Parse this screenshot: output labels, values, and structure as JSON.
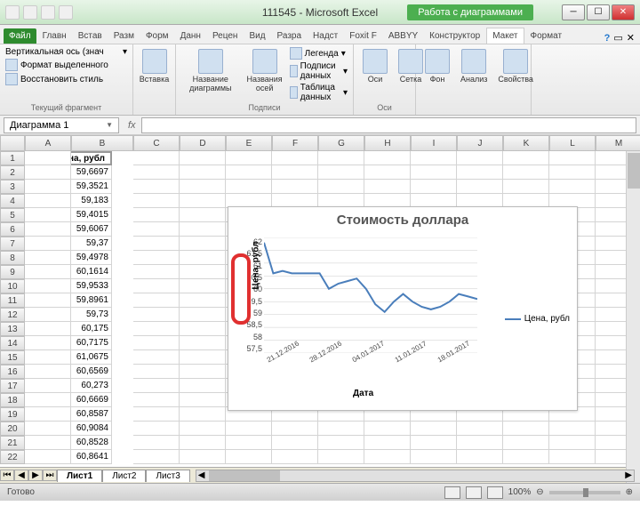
{
  "window": {
    "title": "111545 - Microsoft Excel",
    "chart_tools_label": "Работа с диаграммами"
  },
  "ribbon_tabs": {
    "file": "Файл",
    "tabs": [
      "Главн",
      "Встав",
      "Разм",
      "Форм",
      "Данн",
      "Рецен",
      "Вид",
      "Разра",
      "Надст",
      "Foxit F",
      "ABBYY",
      "Конструктор",
      "Макет",
      "Формат"
    ],
    "active_index": 12
  },
  "ribbon": {
    "group1": {
      "dropdown": "Вертикальная ось (знач",
      "btn1": "Формат выделенного",
      "btn2": "Восстановить стиль",
      "label": "Текущий фрагмент"
    },
    "group2": {
      "btn": "Вставка"
    },
    "group3": {
      "btn1": "Название\nдиаграммы",
      "btn2": "Названия\nосей",
      "s1": "Легенда",
      "s2": "Подписи данных",
      "s3": "Таблица данных",
      "label": "Подписи"
    },
    "group4": {
      "btn1": "Оси",
      "btn2": "Сетка",
      "label": "Оси"
    },
    "group5": {
      "btn1": "Фон",
      "btn2": "Анализ",
      "btn3": "Свойства"
    }
  },
  "namebox": "Диаграмма 1",
  "fx_label": "fx",
  "columns": [
    "A",
    "B",
    "C",
    "D",
    "E",
    "F",
    "G",
    "H",
    "I",
    "J",
    "K",
    "L",
    "M"
  ],
  "header_cell": "Цена, рубл",
  "prices": [
    "59,6697",
    "59,3521",
    "59,183",
    "59,4015",
    "59,6067",
    "59,37",
    "59,4978",
    "60,1614",
    "59,9533",
    "59,8961",
    "59,73",
    "60,175",
    "60,7175",
    "61,0675",
    "60,6569",
    "60,273",
    "60,6669",
    "60,8587",
    "60,9084",
    "60,8528",
    "60,8641"
  ],
  "chart": {
    "title": "Стоимость доллара",
    "y_title": "Цена, рубл",
    "x_title": "Дата",
    "legend": "Цена, рубл",
    "y_ticks": [
      "62",
      "61,5",
      "61",
      "60,5",
      "60",
      "59,5",
      "59",
      "58,5",
      "58",
      "57,5"
    ],
    "x_ticks": [
      "21.12.2016",
      "28.12.2016",
      "04.01.2017",
      "11.01.2017",
      "18.01.2017"
    ]
  },
  "chart_data": {
    "type": "line",
    "title": "Стоимость доллара",
    "xlabel": "Дата",
    "ylabel": "Цена, рубл",
    "ylim": [
      57.5,
      62
    ],
    "x_ticks": [
      "21.12.2016",
      "28.12.2016",
      "04.01.2017",
      "11.01.2017",
      "18.01.2017"
    ],
    "series": [
      {
        "name": "Цена, рубл",
        "values": [
          61.8,
          60.6,
          60.7,
          60.6,
          60.6,
          60.6,
          60.6,
          60.0,
          60.2,
          60.3,
          60.4,
          60.0,
          59.4,
          59.1,
          59.5,
          59.8,
          59.5,
          59.3,
          59.2,
          59.3,
          59.5,
          59.8,
          59.7,
          59.6
        ]
      }
    ]
  },
  "sheets": {
    "active": "Лист1",
    "others": [
      "Лист2",
      "Лист3"
    ]
  },
  "status": {
    "ready": "Готово",
    "zoom": "100%"
  }
}
